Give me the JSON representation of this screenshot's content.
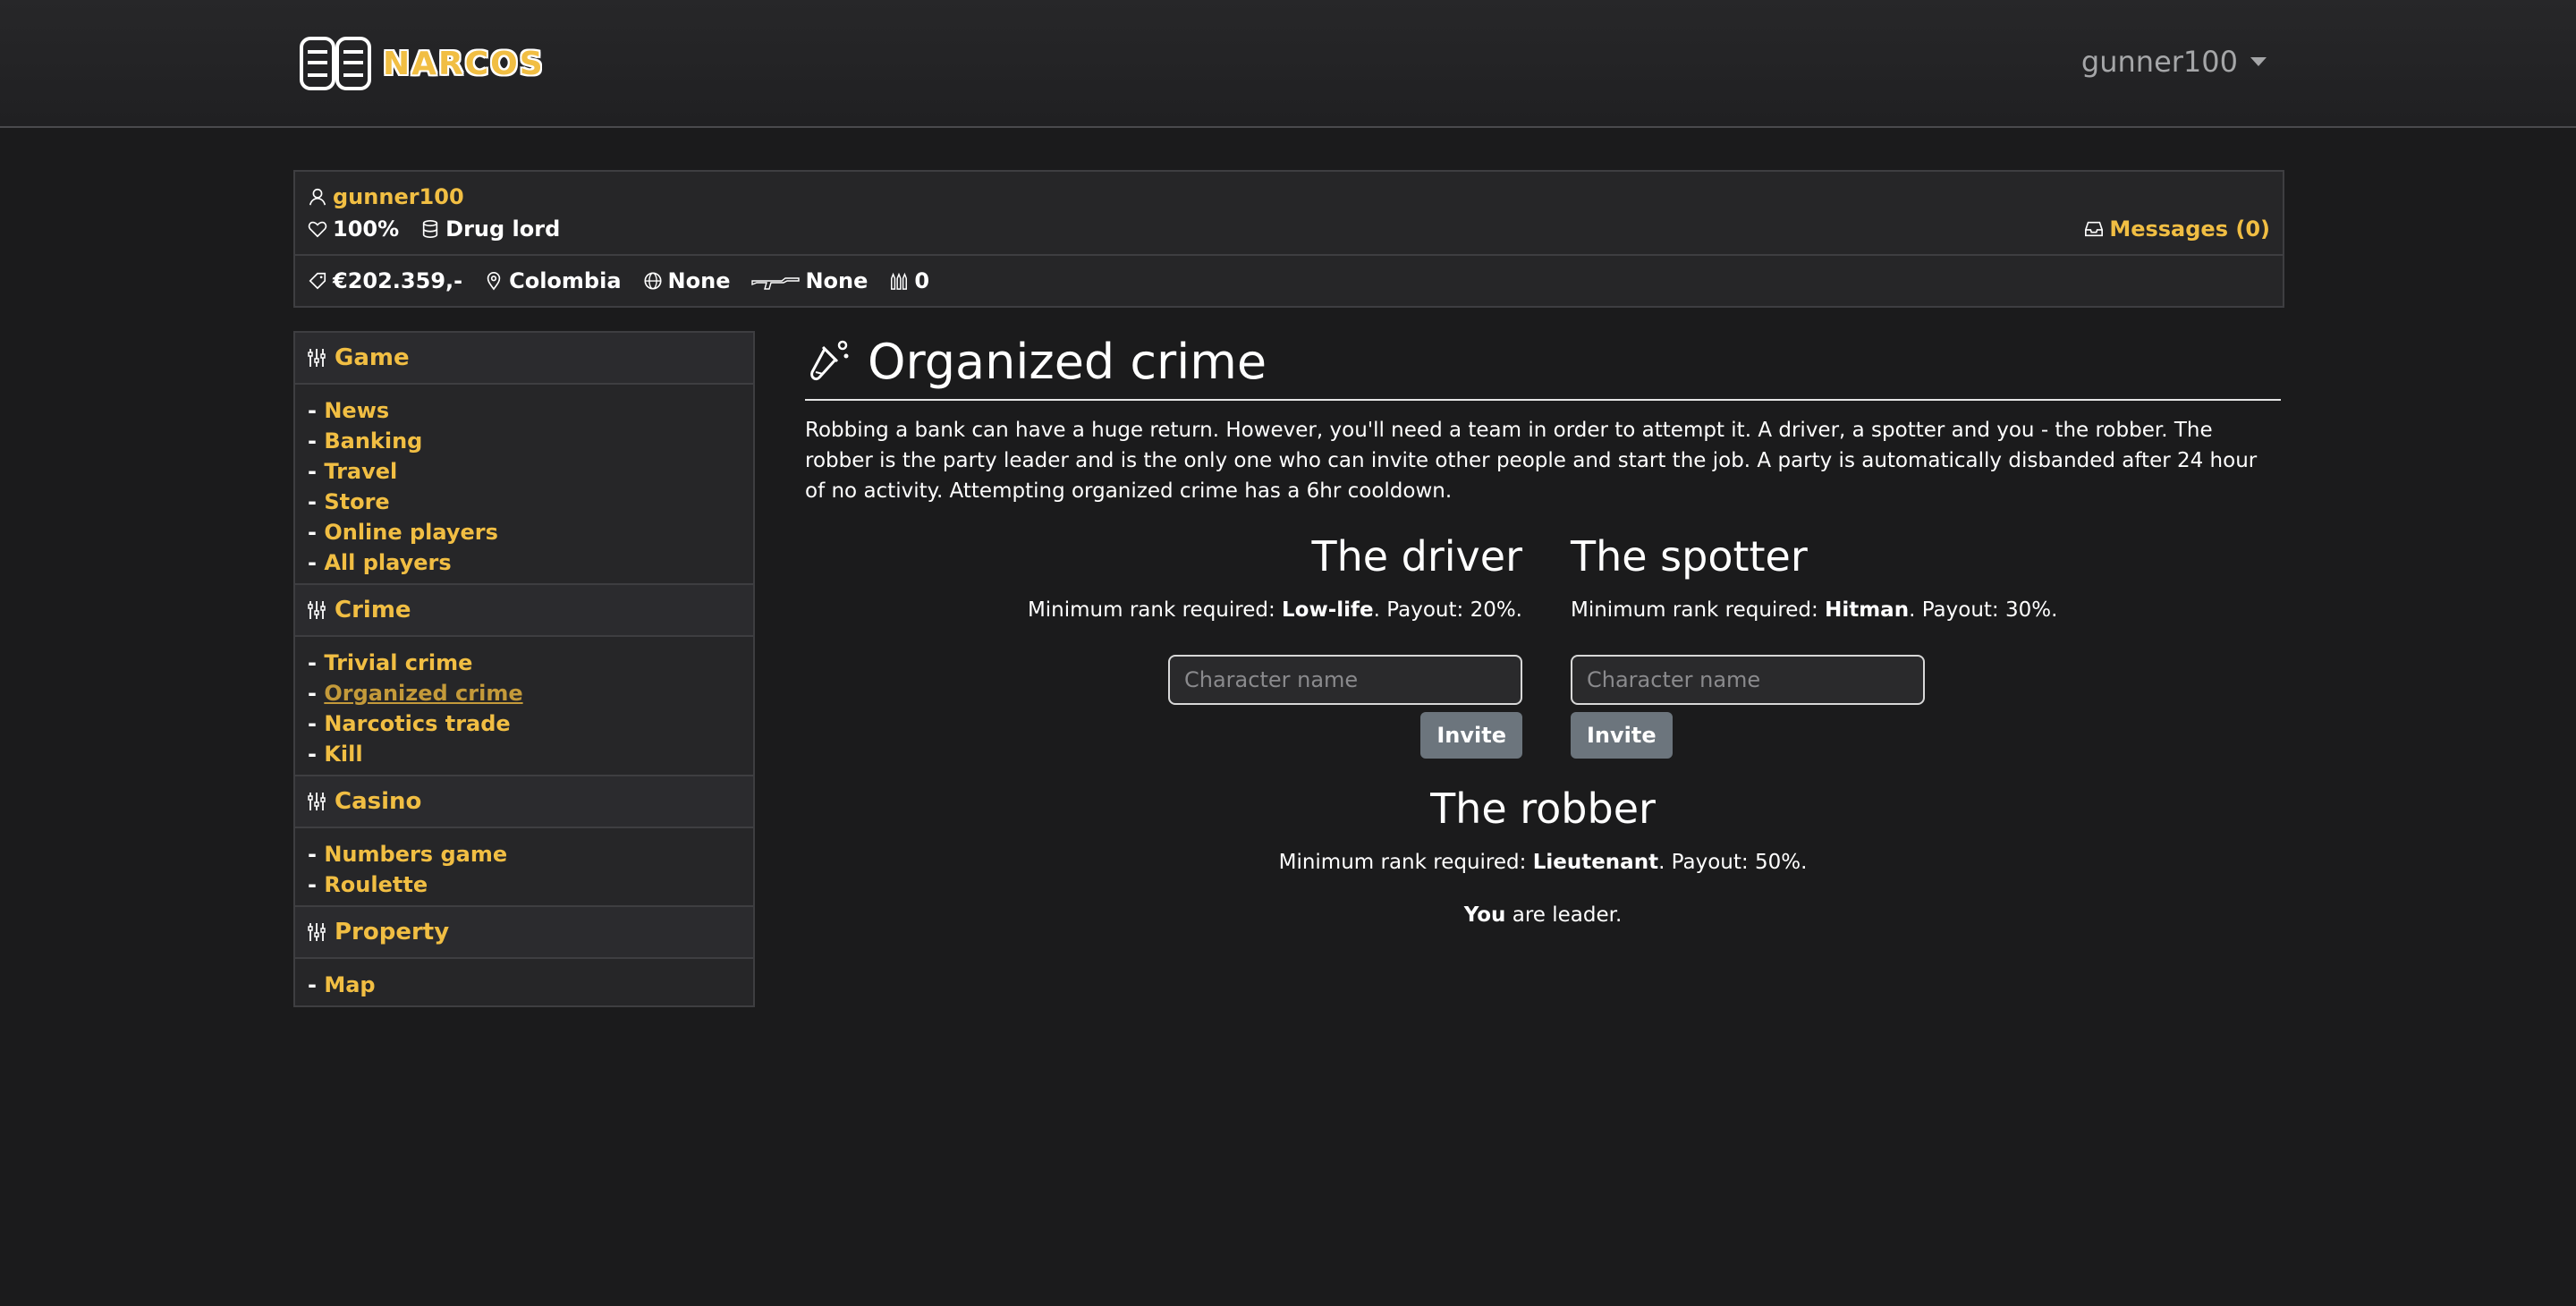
{
  "navbar": {
    "brand": "NARCOS",
    "user": "gunner100"
  },
  "stats": {
    "username": "gunner100",
    "health": "100%",
    "rank": "Drug lord",
    "messages": "Messages (0)",
    "money": "€202.359,-",
    "location": "Colombia",
    "country": "None",
    "weapon": "None",
    "bullets": "0"
  },
  "sidebar": {
    "sections": [
      {
        "title": "Game",
        "items": [
          "News",
          "Banking",
          "Travel",
          "Store",
          "Online players",
          "All players"
        ]
      },
      {
        "title": "Crime",
        "items": [
          "Trivial crime",
          "Organized crime",
          "Narcotics trade",
          "Kill"
        ]
      },
      {
        "title": "Casino",
        "items": [
          "Numbers game",
          "Roulette"
        ]
      },
      {
        "title": "Property",
        "items": [
          "Map"
        ]
      }
    ],
    "active": "Organized crime",
    "bullet": "- "
  },
  "main": {
    "title": "Organized crime",
    "intro": "Robbing a bank can have a huge return. However, you'll need a team in order to attempt it. A driver, a spotter and you - the robber. The robber is the party leader and is the only one who can invite other people and start the job. A party is automatically disbanded after 24 hour of no activity. Attempting organized crime has a 6hr cooldown.",
    "req_prefix": "Minimum rank required: ",
    "payout_prefix": ". Payout: ",
    "driver": {
      "title": "The driver",
      "rank": "Low-life",
      "payout": "20%."
    },
    "spotter": {
      "title": "The spotter",
      "rank": "Hitman",
      "payout": "30%."
    },
    "robber": {
      "title": "The robber",
      "rank": "Lieutenant",
      "payout": "50%."
    },
    "input_placeholder": "Character name",
    "invite_label": "Invite",
    "leader_bold": "You",
    "leader_rest": " are leader."
  }
}
